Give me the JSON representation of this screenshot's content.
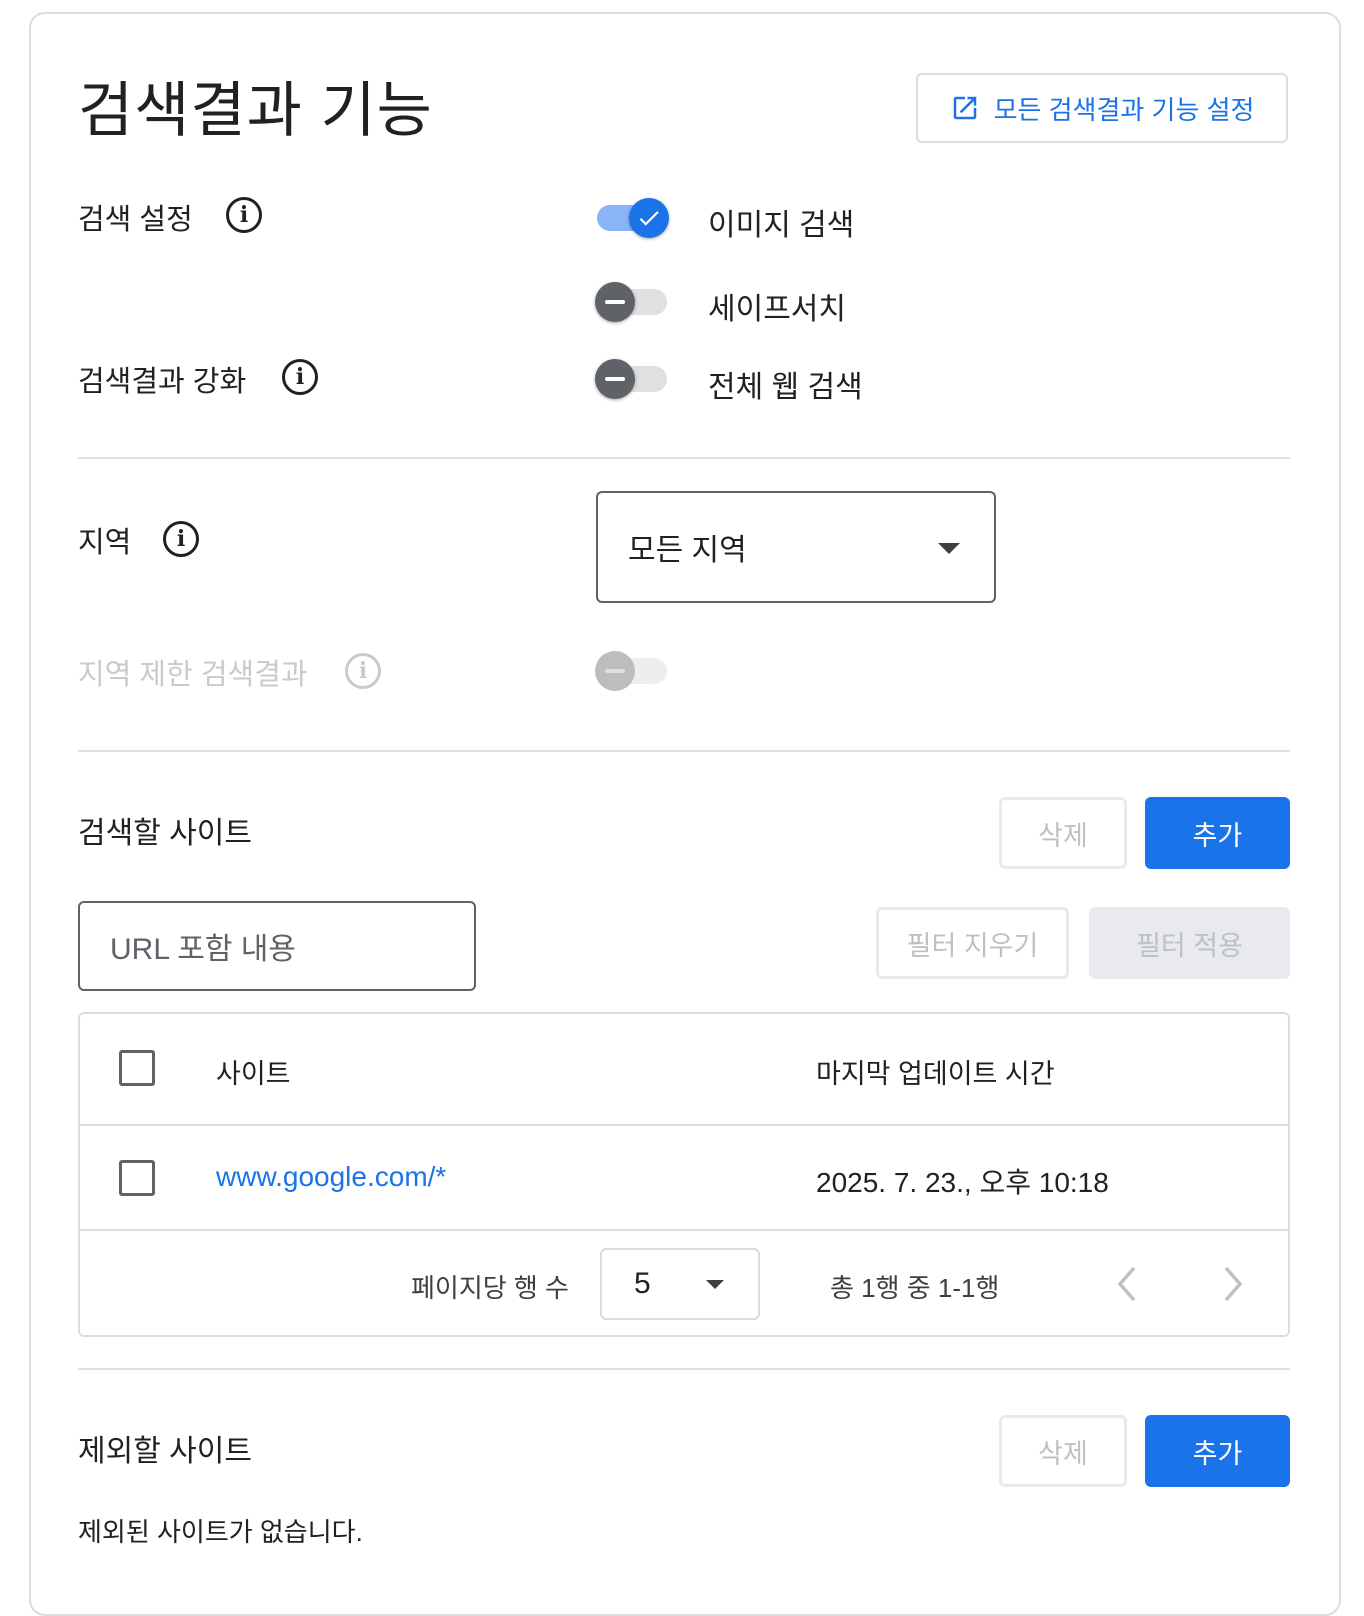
{
  "header": {
    "title": "검색결과 기능",
    "all_settings_label": "모든 검색결과 기능 설정"
  },
  "search_settings": {
    "label": "검색 설정",
    "toggles": [
      {
        "label": "이미지 검색",
        "state": "on"
      },
      {
        "label": "세이프서치",
        "state": "off"
      }
    ]
  },
  "enhancement": {
    "label": "검색결과 강화",
    "toggle": {
      "label": "전체 웹 검색",
      "state": "off"
    }
  },
  "region": {
    "label": "지역",
    "selected": "모든 지역",
    "restricted_label": "지역 제한 검색결과",
    "restricted_state": "disabled"
  },
  "sites_to_search": {
    "title": "검색할 사이트",
    "delete_label": "삭제",
    "add_label": "추가",
    "filter_placeholder": "URL 포함 내용",
    "clear_filter_label": "필터 지우기",
    "apply_filter_label": "필터 적용",
    "table": {
      "columns": [
        "사이트",
        "마지막 업데이트 시간"
      ],
      "rows": [
        {
          "site": "www.google.com/*",
          "updated": "2025. 7. 23., 오후 10:18"
        }
      ],
      "rows_per_page_label": "페이지당 행 수",
      "rows_per_page": "5",
      "range_text": "총 1행 중 1-1행"
    }
  },
  "sites_to_exclude": {
    "title": "제외할 사이트",
    "delete_label": "삭제",
    "add_label": "추가",
    "empty_text": "제외된 사이트가 없습니다."
  },
  "colors": {
    "accent": "#1a73e8",
    "toggle_track_on": "#8ab4f8",
    "toggle_knob_off": "#5f6368",
    "disabled_text": "#bdc1c6"
  }
}
